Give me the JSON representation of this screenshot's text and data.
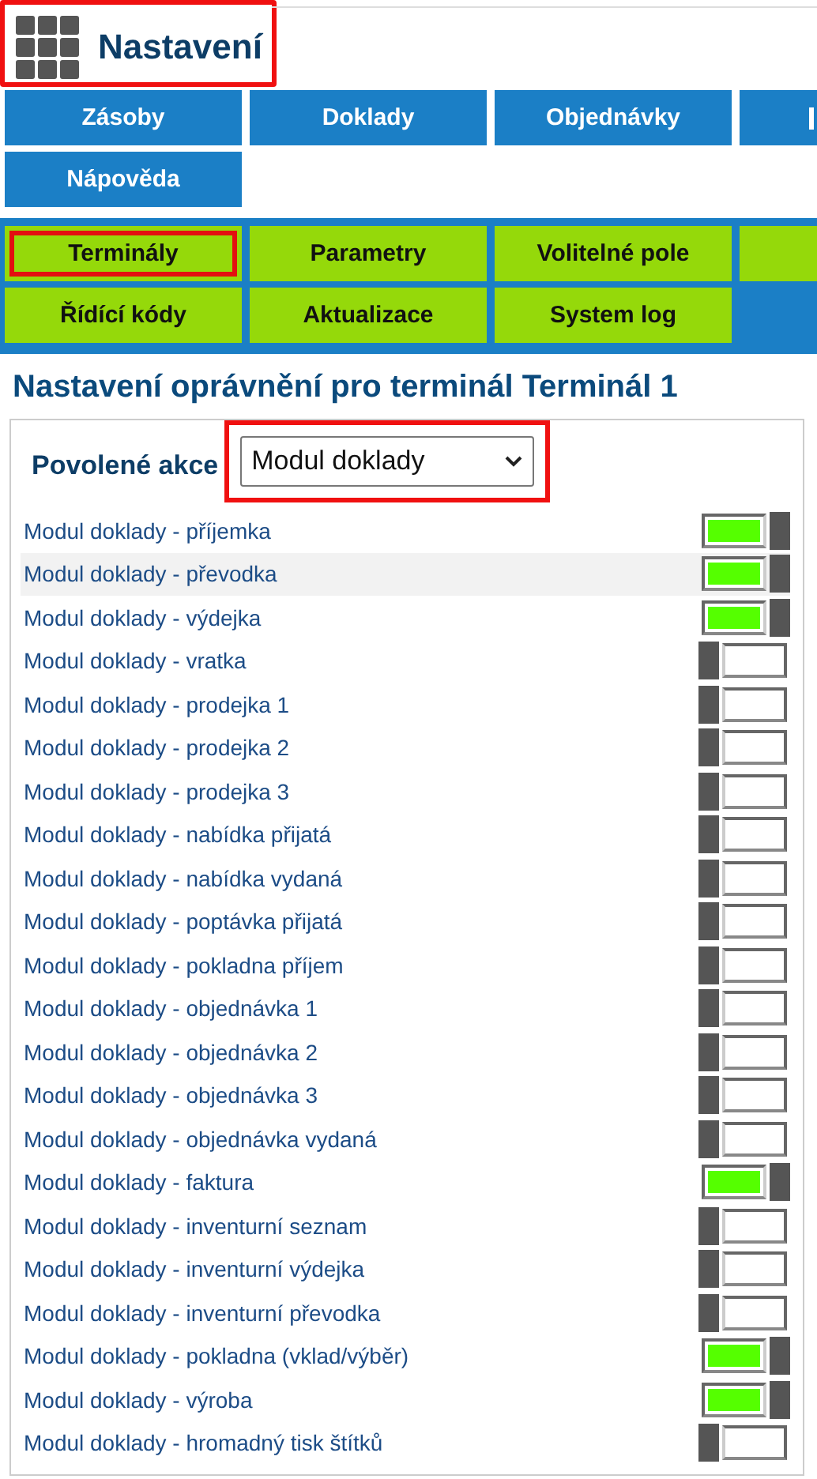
{
  "header": {
    "title": "Nastavení"
  },
  "main_nav": [
    {
      "label": "Zásoby"
    },
    {
      "label": "Doklady"
    },
    {
      "label": "Objednávky"
    },
    {
      "kind": "clipped"
    },
    {
      "label": "Nápověda"
    }
  ],
  "sub_nav": [
    {
      "label": "Terminály",
      "selected": true
    },
    {
      "label": "Parametry",
      "selected": false
    },
    {
      "label": "Volitelné pole",
      "selected": false
    },
    {
      "selected": false
    },
    {
      "label": "Řídící kódy",
      "selected": false
    },
    {
      "label": "Aktualizace",
      "selected": false
    },
    {
      "label": "System log",
      "selected": false
    }
  ],
  "heading": "Nastavení oprávnění pro terminál Terminál 1",
  "filter": {
    "label": "Povolené akce",
    "value": "Modul doklady"
  },
  "permissions": [
    {
      "label": "Modul doklady - příjemka",
      "on": true,
      "highlighted": false
    },
    {
      "label": "Modul doklady - převodka",
      "on": true,
      "highlighted": true
    },
    {
      "label": "Modul doklady - výdejka",
      "on": true,
      "highlighted": false
    },
    {
      "label": "Modul doklady - vratka",
      "on": false,
      "highlighted": false
    },
    {
      "label": "Modul doklady - prodejka 1",
      "on": false,
      "highlighted": false
    },
    {
      "label": "Modul doklady - prodejka 2",
      "on": false,
      "highlighted": false
    },
    {
      "label": "Modul doklady - prodejka 3",
      "on": false,
      "highlighted": false
    },
    {
      "label": "Modul doklady - nabídka přijatá",
      "on": false,
      "highlighted": false
    },
    {
      "label": "Modul doklady - nabídka vydaná",
      "on": false,
      "highlighted": false
    },
    {
      "label": "Modul doklady - poptávka přijatá",
      "on": false,
      "highlighted": false
    },
    {
      "label": "Modul doklady - pokladna příjem",
      "on": false,
      "highlighted": false
    },
    {
      "label": "Modul doklady - objednávka 1",
      "on": false,
      "highlighted": false
    },
    {
      "label": "Modul doklady - objednávka 2",
      "on": false,
      "highlighted": false
    },
    {
      "label": "Modul doklady - objednávka 3",
      "on": false,
      "highlighted": false
    },
    {
      "label": "Modul doklady - objednávka vydaná",
      "on": false,
      "highlighted": false
    },
    {
      "label": "Modul doklady - faktura",
      "on": true,
      "highlighted": false
    },
    {
      "label": "Modul doklady - inventurní seznam",
      "on": false,
      "highlighted": false
    },
    {
      "label": "Modul doklady - inventurní výdejka",
      "on": false,
      "highlighted": false
    },
    {
      "label": "Modul doklady - inventurní převodka",
      "on": false,
      "highlighted": false
    },
    {
      "label": "Modul doklady - pokladna (vklad/výběr)",
      "on": true,
      "highlighted": false
    },
    {
      "label": "Modul doklady - výroba",
      "on": true,
      "highlighted": false
    },
    {
      "label": "Modul doklady - hromadný tisk štítků",
      "on": false,
      "highlighted": false
    }
  ]
}
